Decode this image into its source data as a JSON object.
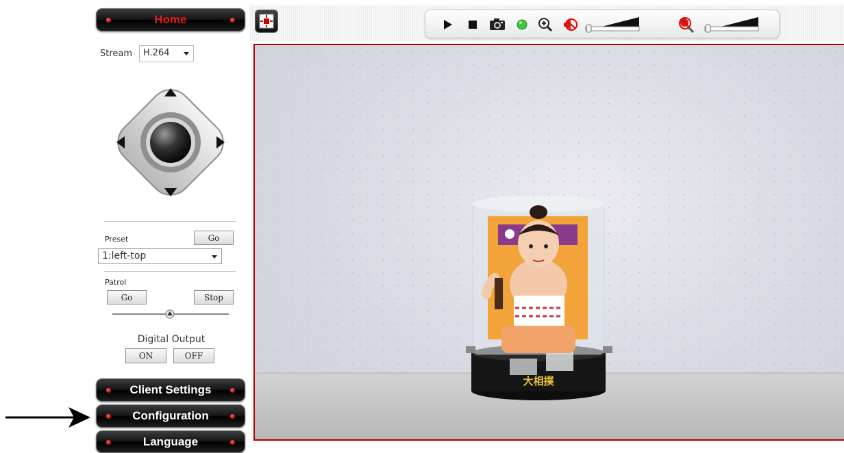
{
  "nav": {
    "home": "Home",
    "client_settings": "Client Settings",
    "configuration": "Configuration",
    "language": "Language"
  },
  "stream": {
    "label": "Stream",
    "value": "H.264"
  },
  "preset": {
    "label": "Preset",
    "go": "Go",
    "value": "1:left-top"
  },
  "patrol": {
    "label": "Patrol",
    "go": "Go",
    "stop": "Stop"
  },
  "digital_output": {
    "label": "Digital Output",
    "on": "ON",
    "off": "OFF"
  },
  "toolbar": {
    "icons": [
      "fullscreen-icon",
      "play-icon",
      "stop-icon",
      "snapshot-icon",
      "record-indicator-icon",
      "zoom-in-icon",
      "speaker-muted-icon",
      "microphone-muted-icon"
    ],
    "speaker_volume": 0,
    "microphone_volume": 0
  },
  "colors": {
    "accent_red": "#e41b1b",
    "video_border": "#b30000",
    "record_green": "#3fc43f"
  },
  "video": {
    "figure_text": "大相撲"
  }
}
